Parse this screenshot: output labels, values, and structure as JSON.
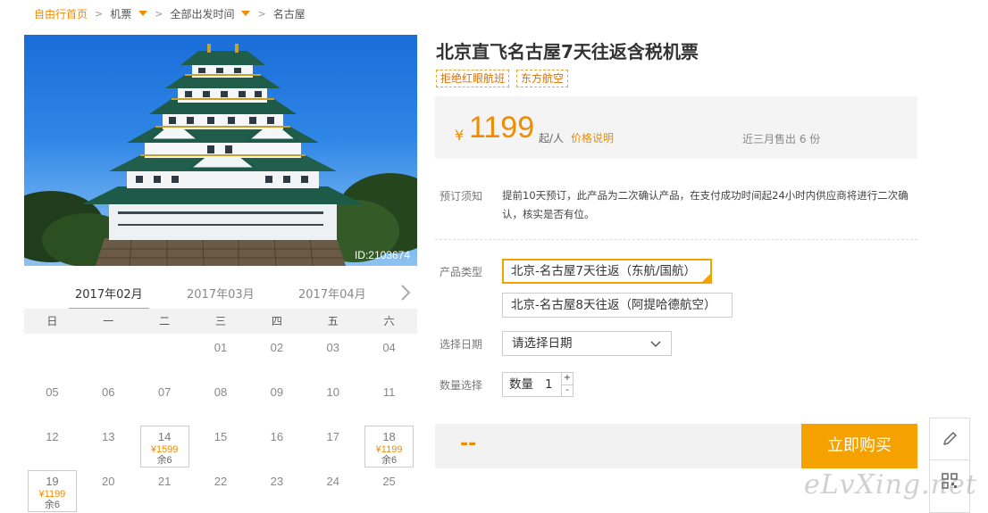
{
  "breadcrumb": {
    "home": "自由行首页",
    "ticket": "机票",
    "departure": "全部出发时间",
    "destination": "名古屋",
    "separator": ">"
  },
  "photo": {
    "id_label": "ID:2103674"
  },
  "calendar": {
    "tabs": [
      "2017年02月",
      "2017年03月",
      "2017年04月"
    ],
    "active_tab": 0,
    "weekdays": [
      "日",
      "一",
      "二",
      "三",
      "四",
      "五",
      "六"
    ],
    "days": [
      {
        "d": ""
      },
      {
        "d": ""
      },
      {
        "d": ""
      },
      {
        "d": "01"
      },
      {
        "d": "02"
      },
      {
        "d": "03"
      },
      {
        "d": "04"
      },
      {
        "d": "05"
      },
      {
        "d": "06"
      },
      {
        "d": "07"
      },
      {
        "d": "08"
      },
      {
        "d": "09"
      },
      {
        "d": "10"
      },
      {
        "d": "11"
      },
      {
        "d": "12"
      },
      {
        "d": "13"
      },
      {
        "d": "14",
        "price": "¥1599",
        "left": "余6"
      },
      {
        "d": "15"
      },
      {
        "d": "16"
      },
      {
        "d": "17"
      },
      {
        "d": "18",
        "price": "¥1199",
        "left": "余6"
      },
      {
        "d": "19",
        "price": "¥1199",
        "left": "余6"
      },
      {
        "d": "20"
      },
      {
        "d": "21"
      },
      {
        "d": "22"
      },
      {
        "d": "23"
      },
      {
        "d": "24"
      },
      {
        "d": "25"
      }
    ]
  },
  "product": {
    "title": "北京直飞名古屋7天往返含税机票",
    "tags": [
      "拒绝红眼航班",
      "东方航空"
    ],
    "currency": "¥",
    "price": "1199",
    "per_person": "起/人",
    "price_explain": "价格说明",
    "sold": "近三月售出 6 份"
  },
  "booking": {
    "notice_label": "预订须知",
    "notice_text": "提前10天预订，此产品为二次确认产品，在支付成功时间起24小时内供应商将进行二次确认，核实是否有位。",
    "type_label": "产品类型",
    "type_options": [
      "北京-名古屋7天往返（东航/国航）",
      "北京-名古屋8天往返（阿提哈德航空）"
    ],
    "selected_type": 0,
    "date_label": "选择日期",
    "date_placeholder": "请选择日期",
    "qty_label": "数量选择",
    "qty_prefix": "数量",
    "qty_value": "1",
    "qty_plus": "+",
    "qty_minus": "-"
  },
  "buy": {
    "total": "--",
    "button": "立即购买"
  },
  "watermark": "eLvXing.net",
  "colors": {
    "accent": "#f5a100",
    "price": "#f08c00"
  }
}
